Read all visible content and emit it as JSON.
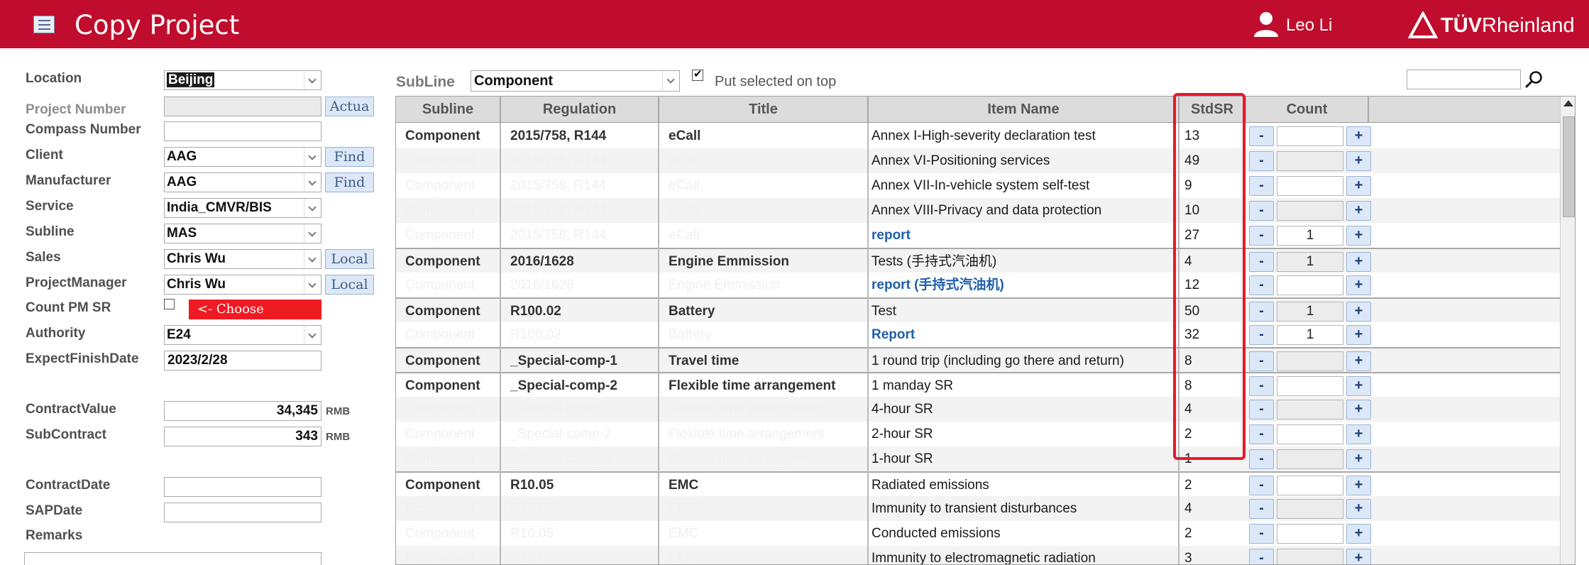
{
  "header": {
    "title": "Copy Project",
    "user_name": "Leo Li",
    "logo_text_bold": "TÜV",
    "logo_text_rest": "Rheinland"
  },
  "form": {
    "location": {
      "label": "Location",
      "value": "Beijing"
    },
    "project_number": {
      "label": "Project Number",
      "value": "",
      "button": "Actua"
    },
    "compass_number": {
      "label": "Compass Number",
      "value": ""
    },
    "client": {
      "label": "Client",
      "value": "AAG",
      "button": "Find"
    },
    "manufacturer": {
      "label": "Manufacturer",
      "value": "AAG",
      "button": "Find"
    },
    "service": {
      "label": "Service",
      "value": "India_CMVR/BIS"
    },
    "subline": {
      "label": "Subline",
      "value": "MAS"
    },
    "sales": {
      "label": "Sales",
      "value": "Chris Wu",
      "button": "Local"
    },
    "project_manager": {
      "label": "ProjectManager",
      "value": "Chris Wu",
      "button": "Local"
    },
    "count_pm_sr": {
      "label": "Count PM SR",
      "checked": false,
      "choose_label": "<- Choose"
    },
    "authority": {
      "label": "Authority",
      "value": "E24"
    },
    "expect_finish_date": {
      "label": "ExpectFinishDate",
      "value": "2023/2/28"
    },
    "contract_value": {
      "label": "ContractValue",
      "value": "34,345",
      "unit": "RMB"
    },
    "sub_contract": {
      "label": "SubContract",
      "value": "343",
      "unit": "RMB"
    },
    "contract_date": {
      "label": "ContractDate",
      "value": ""
    },
    "sap_date": {
      "label": "SAPDate",
      "value": ""
    },
    "remarks": {
      "label": "Remarks",
      "value": ""
    }
  },
  "toolbar": {
    "subline_label": "SubLine",
    "subline_value": "Component",
    "put_on_top_checked": true,
    "put_on_top_label": "Put selected on top",
    "search_value": ""
  },
  "grid": {
    "columns": [
      "Subline",
      "Regulation",
      "Title",
      "Item Name",
      "StdSR",
      "Count"
    ],
    "rows": [
      {
        "subline": "Component",
        "regulation": "2015/758, R144",
        "title": "eCall",
        "item": "Annex I-High-severity declaration test",
        "std": "13",
        "count": "",
        "group": true,
        "link": false,
        "count_enabled": true
      },
      {
        "subline": "Component",
        "regulation": "2015/758, R144",
        "title": "eCall",
        "item": "Annex VI-Positioning services",
        "std": "49",
        "count": "",
        "group": false,
        "link": false,
        "count_enabled": false
      },
      {
        "subline": "Component",
        "regulation": "2015/758, R144",
        "title": "eCall",
        "item": "Annex VII-In-vehicle system self-test",
        "std": "9",
        "count": "",
        "group": false,
        "link": false,
        "count_enabled": true
      },
      {
        "subline": "Component",
        "regulation": "2015/758, R144",
        "title": "eCall",
        "item": "Annex VIII-Privacy and data protection",
        "std": "10",
        "count": "",
        "group": false,
        "link": false,
        "count_enabled": false
      },
      {
        "subline": "Component",
        "regulation": "2015/758, R144",
        "title": "eCall",
        "item": "report",
        "std": "27",
        "count": "1",
        "group": false,
        "link": true,
        "count_enabled": true
      },
      {
        "subline": "Component",
        "regulation": "2016/1628",
        "title": "Engine Emmission",
        "item": "Tests (手持式汽油机)",
        "std": "4",
        "count": "1",
        "group": true,
        "link": false,
        "count_enabled": false
      },
      {
        "subline": "Component",
        "regulation": "2016/1628",
        "title": "Engine Emmission",
        "item": "report (手持式汽油机)",
        "std": "12",
        "count": "",
        "group": false,
        "link": true,
        "count_enabled": true
      },
      {
        "subline": "Component",
        "regulation": "R100.02",
        "title": "Battery",
        "item": "Test",
        "std": "50",
        "count": "1",
        "group": true,
        "link": false,
        "count_enabled": false
      },
      {
        "subline": "Component",
        "regulation": "R100.02",
        "title": "Battery",
        "item": "Report",
        "std": "32",
        "count": "1",
        "group": false,
        "link": true,
        "count_enabled": true
      },
      {
        "subline": "Component",
        "regulation": "_Special-comp-1",
        "title": "Travel time",
        "item": "1 round trip (including go there and return)",
        "std": "8",
        "count": "",
        "group": true,
        "link": false,
        "count_enabled": false
      },
      {
        "subline": "Component",
        "regulation": "_Special-comp-2",
        "title": "Flexible time arrangement",
        "item": "1 manday SR",
        "std": "8",
        "count": "",
        "group": true,
        "link": false,
        "count_enabled": true
      },
      {
        "subline": "Component",
        "regulation": "_Special-comp-2",
        "title": "Flexible time arrangement",
        "item": "4-hour SR",
        "std": "4",
        "count": "",
        "group": false,
        "link": false,
        "count_enabled": false
      },
      {
        "subline": "Component",
        "regulation": "_Special-comp-2",
        "title": "Flexible time arrangement",
        "item": "2-hour SR",
        "std": "2",
        "count": "",
        "group": false,
        "link": false,
        "count_enabled": true
      },
      {
        "subline": "Component",
        "regulation": "_Special-comp-2",
        "title": "Flexible time arrangement",
        "item": "1-hour SR",
        "std": "1",
        "count": "",
        "group": false,
        "link": false,
        "count_enabled": false
      },
      {
        "subline": "Component",
        "regulation": "R10.05",
        "title": "EMC",
        "item": "Radiated emissions",
        "std": "2",
        "count": "",
        "group": true,
        "link": false,
        "count_enabled": true
      },
      {
        "subline": "Component",
        "regulation": "R10.05",
        "title": "EMC",
        "item": "Immunity to transient disturbances",
        "std": "4",
        "count": "",
        "group": false,
        "link": false,
        "count_enabled": false
      },
      {
        "subline": "Component",
        "regulation": "R10.05",
        "title": "EMC",
        "item": "Conducted emissions",
        "std": "2",
        "count": "",
        "group": false,
        "link": false,
        "count_enabled": true
      },
      {
        "subline": "Component",
        "regulation": "R10.05",
        "title": "EMC",
        "item": "Immunity to electromagnetic radiation",
        "std": "3",
        "count": "",
        "group": false,
        "link": false,
        "count_enabled": false
      }
    ],
    "minus_label": "-",
    "plus_label": "+"
  }
}
